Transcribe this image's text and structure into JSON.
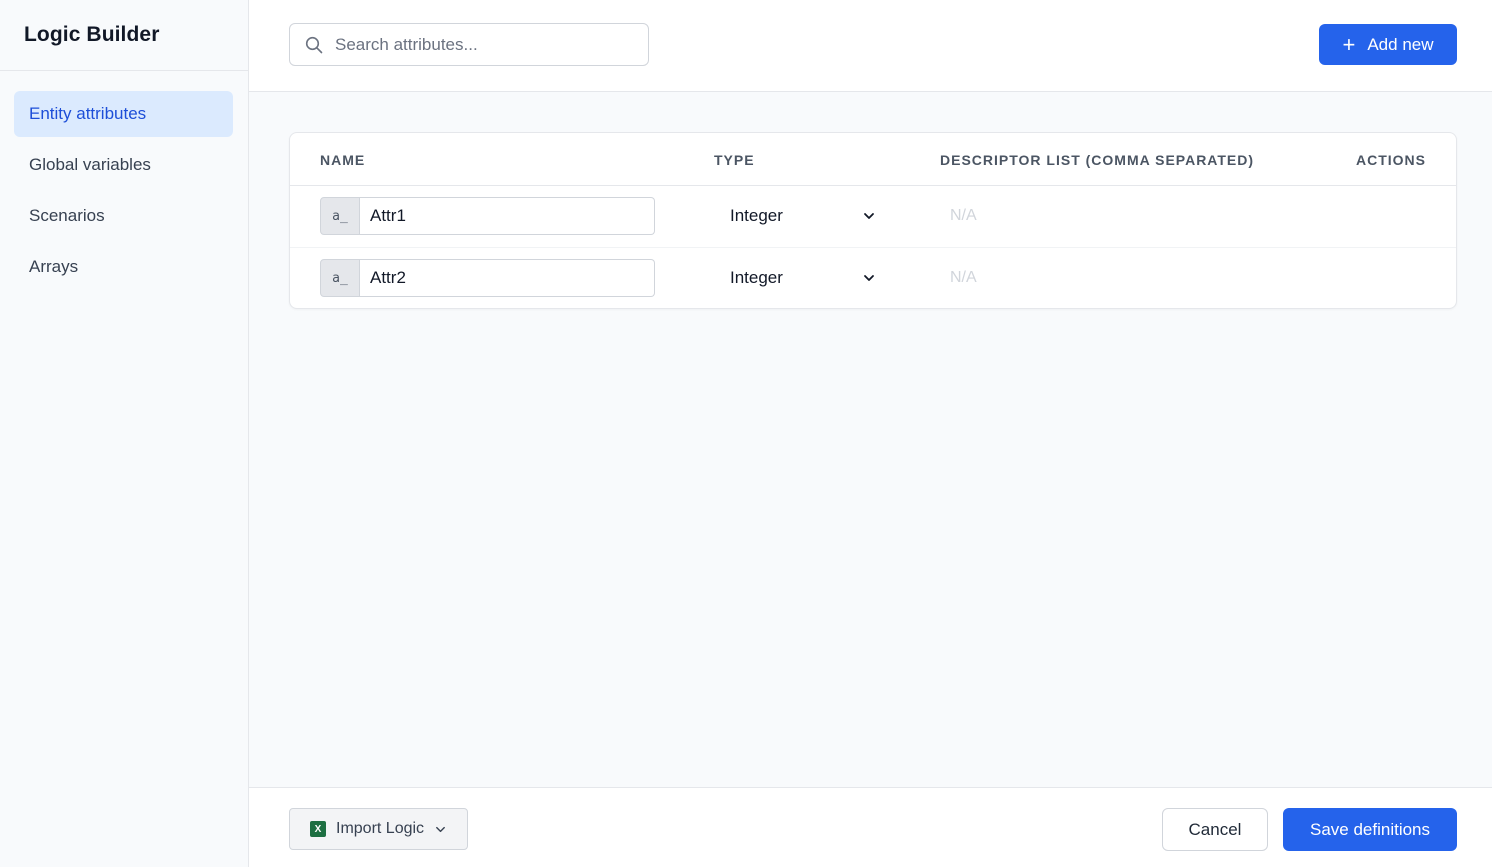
{
  "app": {
    "title": "Logic Builder"
  },
  "sidebar": {
    "items": [
      {
        "label": "Entity attributes",
        "active": true
      },
      {
        "label": "Global variables",
        "active": false
      },
      {
        "label": "Scenarios",
        "active": false
      },
      {
        "label": "Arrays",
        "active": false
      }
    ]
  },
  "search": {
    "placeholder": "Search attributes...",
    "value": "",
    "icon": "search-icon"
  },
  "toolbar": {
    "add_label": "Add new",
    "add_icon": "plus-icon"
  },
  "table": {
    "headers": {
      "name": "NAME",
      "type": "TYPE",
      "descriptor": "DESCRIPTOR LIST (COMMA SEPARATED)",
      "actions": "ACTIONS"
    },
    "rows": [
      {
        "prefix": "a_",
        "name": "Attr1",
        "type": "Integer",
        "descriptor": "N/A"
      },
      {
        "prefix": "a_",
        "name": "Attr2",
        "type": "Integer",
        "descriptor": "N/A"
      }
    ]
  },
  "footer": {
    "import_label": "Import Logic",
    "cancel_label": "Cancel",
    "save_label": "Save definitions"
  },
  "colors": {
    "primary": "#2563eb",
    "active_nav_bg": "#dbeafe",
    "active_nav_text": "#1d4ed8",
    "excel_green": "#1d6f42"
  }
}
